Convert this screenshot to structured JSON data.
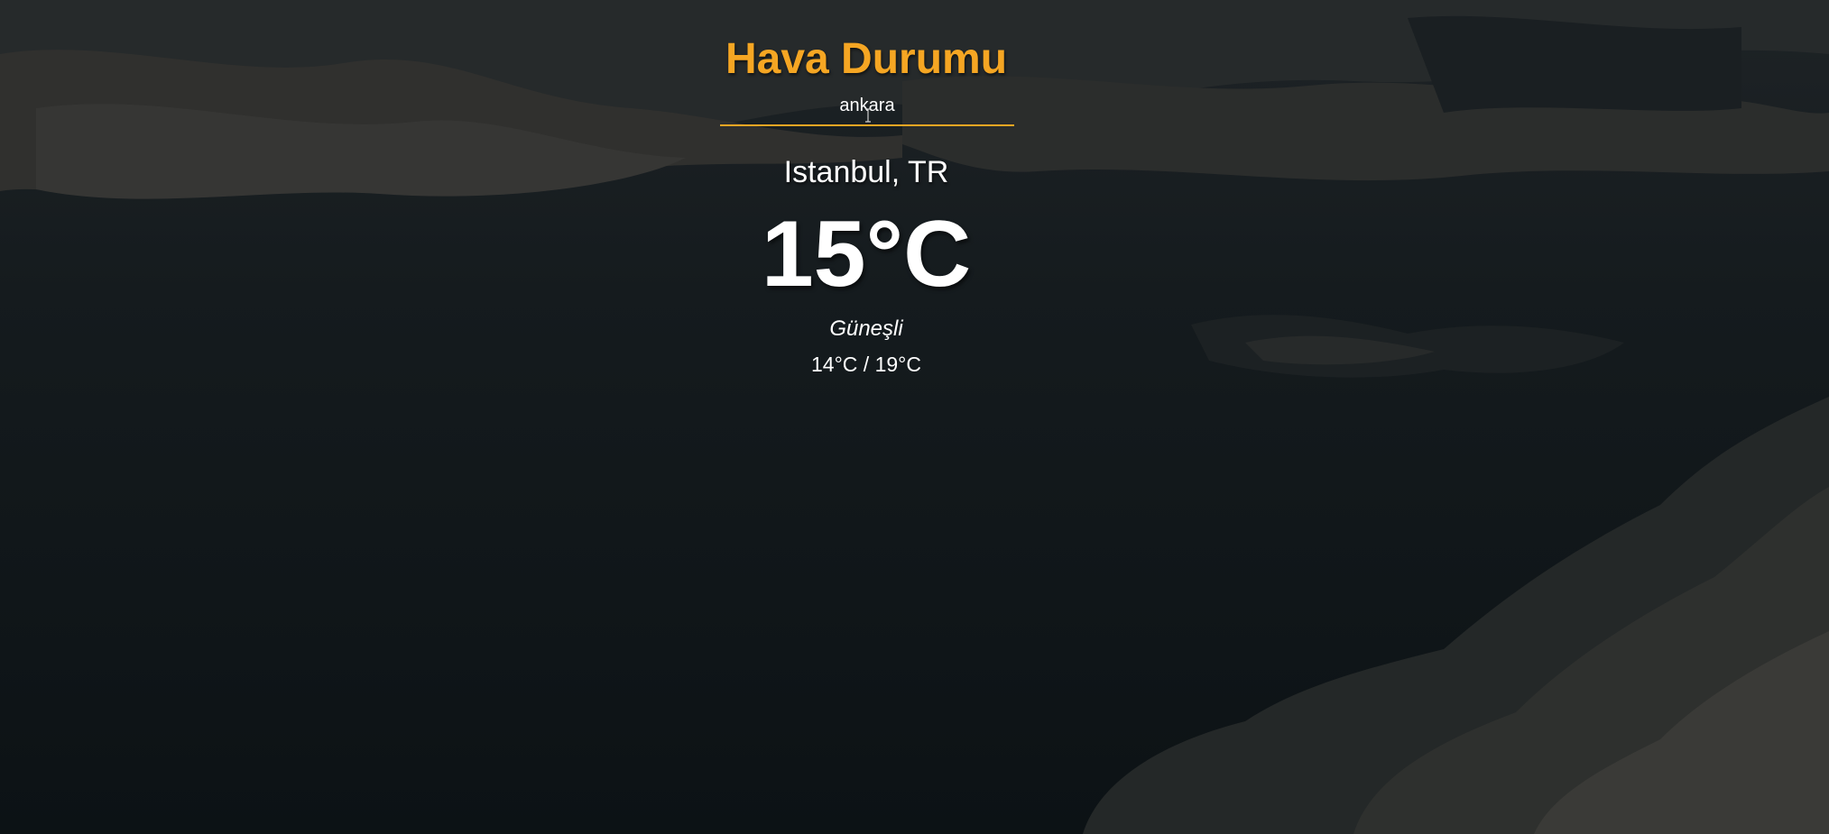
{
  "app": {
    "title": "Hava Durumu"
  },
  "search": {
    "value": "ankara",
    "accent_color": "#f5a623"
  },
  "weather": {
    "location": "Istanbul, TR",
    "temperature": "15°C",
    "description": "Güneşli",
    "hi_low": "14°C / 19°C"
  },
  "background": {
    "icon": "dark-cloudy-sky-image",
    "base_color": "#0f1518"
  }
}
